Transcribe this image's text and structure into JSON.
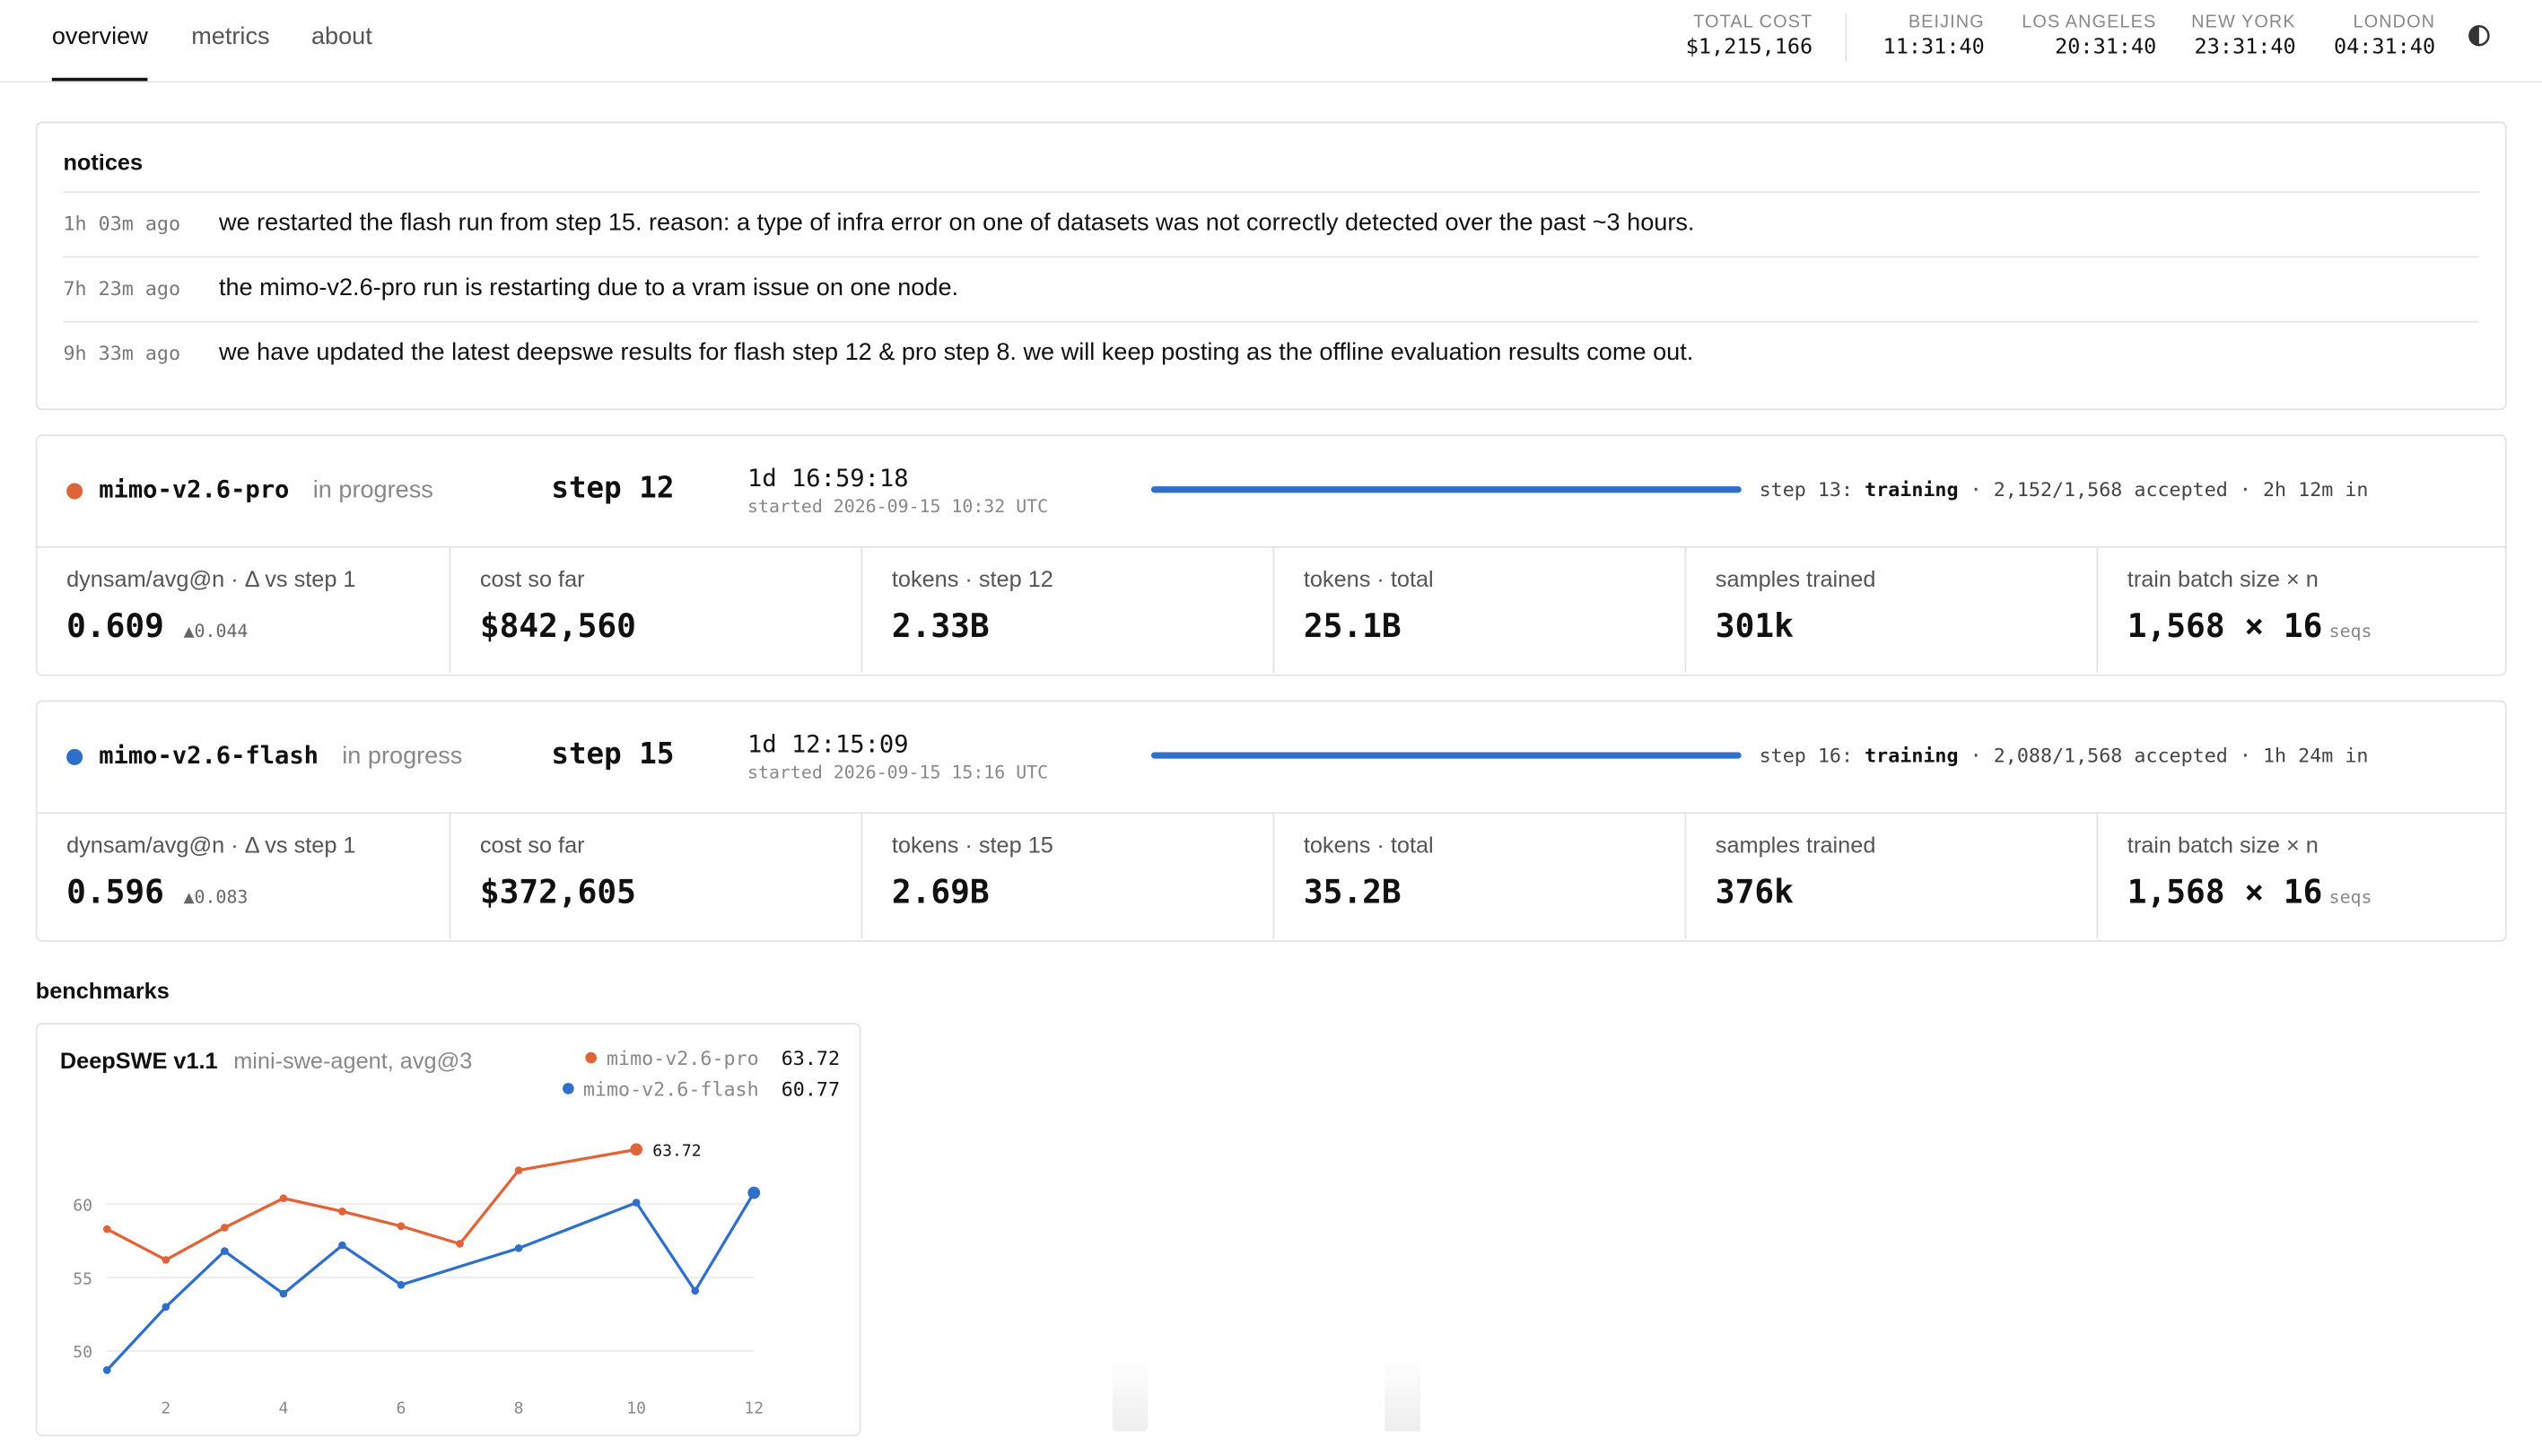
{
  "tabs": [
    {
      "label": "overview",
      "active": true
    },
    {
      "label": "metrics",
      "active": false
    },
    {
      "label": "about",
      "active": false
    }
  ],
  "header_stats": {
    "total_cost": {
      "label": "TOTAL COST",
      "value": "$1,215,166"
    },
    "clocks": [
      {
        "label": "BEIJING",
        "value": "11:31:40"
      },
      {
        "label": "LOS ANGELES",
        "value": "20:31:40"
      },
      {
        "label": "NEW YORK",
        "value": "23:31:40"
      },
      {
        "label": "LONDON",
        "value": "04:31:40"
      }
    ]
  },
  "icons": {
    "theme_toggle": "half-circle-icon"
  },
  "notices": {
    "title": "notices",
    "items": [
      {
        "ago": "1h 03m ago",
        "message": "we restarted the flash run from step 15. reason: a type of infra error on one of datasets was not correctly detected over the past ~3 hours."
      },
      {
        "ago": "7h 23m ago",
        "message": "the mimo-v2.6-pro run is restarting due to a vram issue on one node."
      },
      {
        "ago": "9h 33m ago",
        "message": "we have updated the latest deepswe results for flash step 12 & pro step 8. we will keep posting as the offline evaluation results come out."
      }
    ]
  },
  "runs": [
    {
      "name": "mimo-v2.6-pro",
      "state": "in progress",
      "color": "#e0643a",
      "step": "step 12",
      "elapsed": "1d 16:59:18",
      "started": "started 2026-09-15 10:32 UTC",
      "status_prefix": "step 13:",
      "status_phase": "training",
      "status_suffix": "· 2,152/1,568 accepted · 2h 12m in",
      "metrics": [
        {
          "label": "dynsam/avg@n · Δ vs step 1",
          "value": "0.609",
          "sub": "▲0.044"
        },
        {
          "label": "cost so far",
          "value": "$842,560"
        },
        {
          "label": "tokens · step 12",
          "value": "2.33B"
        },
        {
          "label": "tokens · total",
          "value": "25.1B"
        },
        {
          "label": "samples trained",
          "value": "301k"
        },
        {
          "label": "train batch size × n",
          "value": "1,568 × 16",
          "unit": "seqs"
        }
      ]
    },
    {
      "name": "mimo-v2.6-flash",
      "state": "in progress",
      "color": "#2f6fca",
      "step": "step 15",
      "elapsed": "1d 12:15:09",
      "started": "started 2026-09-15 15:16 UTC",
      "status_prefix": "step 16:",
      "status_phase": "training",
      "status_suffix": "· 2,088/1,568 accepted · 1h 24m in",
      "metrics": [
        {
          "label": "dynsam/avg@n · Δ vs step 1",
          "value": "0.596",
          "sub": "▲0.083"
        },
        {
          "label": "cost so far",
          "value": "$372,605"
        },
        {
          "label": "tokens · step 15",
          "value": "2.69B"
        },
        {
          "label": "tokens · total",
          "value": "35.2B"
        },
        {
          "label": "samples trained",
          "value": "376k"
        },
        {
          "label": "train batch size × n",
          "value": "1,568 × 16",
          "unit": "seqs"
        }
      ]
    }
  ],
  "benchmarks": {
    "section_title": "benchmarks",
    "card_title": "DeepSWE v1.1",
    "card_subtitle": "mini-swe-agent, avg@3",
    "legend": [
      {
        "name": "mimo-v2.6-pro",
        "value": "63.72",
        "color": "#e0643a"
      },
      {
        "name": "mimo-v2.6-flash",
        "value": "60.77",
        "color": "#2f6fca"
      }
    ]
  },
  "chart_data": {
    "type": "line",
    "title": "DeepSWE v1.1",
    "subtitle": "mini-swe-agent, avg@3",
    "xlabel": "",
    "ylabel": "",
    "xlim": [
      1,
      12
    ],
    "ylim": [
      48.5,
      64.5
    ],
    "x_ticks": [
      2,
      4,
      6,
      8,
      10,
      12
    ],
    "y_ticks": [
      50,
      55,
      60
    ],
    "grid": true,
    "legend_position": "top-right",
    "series": [
      {
        "name": "mimo-v2.6-pro",
        "color": "#e0643a",
        "x": [
          1,
          2,
          3,
          4,
          5,
          6,
          7,
          8,
          10
        ],
        "y": [
          58.3,
          56.2,
          58.4,
          60.4,
          59.5,
          58.5,
          57.3,
          62.3,
          63.72
        ],
        "end_label": "63.72"
      },
      {
        "name": "mimo-v2.6-flash",
        "color": "#2f6fca",
        "x": [
          1,
          2,
          3,
          4,
          5,
          6,
          8,
          10,
          11,
          12
        ],
        "y": [
          48.7,
          53.0,
          56.8,
          53.9,
          57.2,
          54.5,
          57.0,
          60.1,
          54.1,
          60.77
        ]
      }
    ]
  }
}
